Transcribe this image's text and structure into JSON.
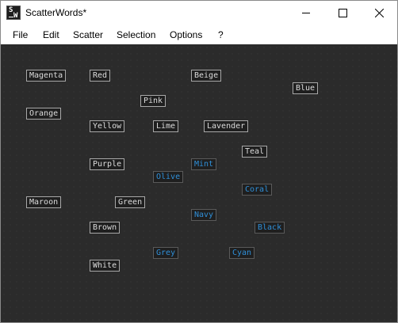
{
  "window": {
    "title": "ScatterWords*",
    "icon_letters": {
      "top": "S",
      "bottom": "W"
    }
  },
  "menu": [
    "File",
    "Edit",
    "Scatter",
    "Selection",
    "Options",
    "?"
  ],
  "words": [
    {
      "text": "Magenta",
      "selected": false
    },
    {
      "text": "Red",
      "selected": false
    },
    {
      "text": "Beige",
      "selected": false
    },
    {
      "text": "Blue",
      "selected": false
    },
    {
      "text": "Pink",
      "selected": false
    },
    {
      "text": "Orange",
      "selected": false
    },
    {
      "text": "Yellow",
      "selected": false
    },
    {
      "text": "Lime",
      "selected": false
    },
    {
      "text": "Lavender",
      "selected": false
    },
    {
      "text": "Teal",
      "selected": false
    },
    {
      "text": "Purple",
      "selected": false
    },
    {
      "text": "Mint",
      "selected": true
    },
    {
      "text": "Olive",
      "selected": true
    },
    {
      "text": "Coral",
      "selected": true
    },
    {
      "text": "Maroon",
      "selected": false
    },
    {
      "text": "Green",
      "selected": false
    },
    {
      "text": "Navy",
      "selected": true
    },
    {
      "text": "Brown",
      "selected": false
    },
    {
      "text": "Black",
      "selected": true
    },
    {
      "text": "Grey",
      "selected": true
    },
    {
      "text": "Cyan",
      "selected": true
    },
    {
      "text": "White",
      "selected": false
    }
  ],
  "colors": {
    "canvas_bg": "#2b2b2b",
    "word_text": "#dcdcdc",
    "selected_word_text": "#2f8fd8"
  }
}
